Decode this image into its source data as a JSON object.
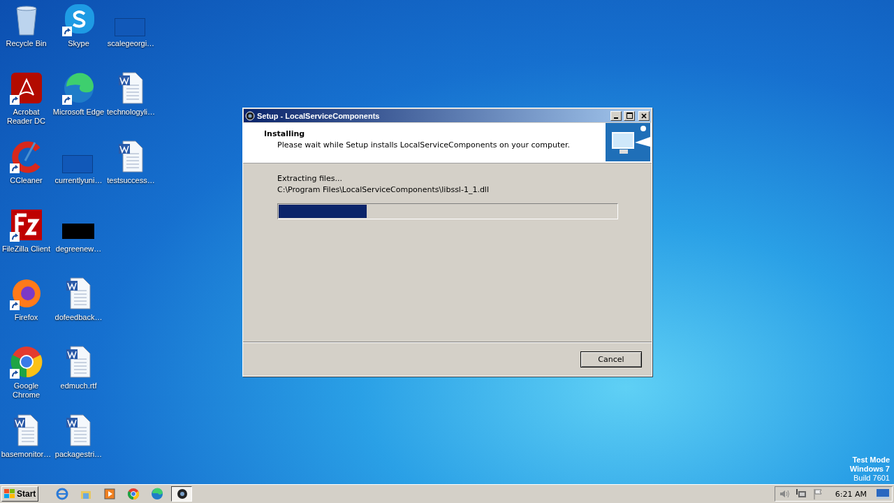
{
  "desktop_icons": [
    {
      "label": "Recycle Bin",
      "kind": "recycle",
      "shortcut": false
    },
    {
      "label": "Acrobat Reader DC",
      "kind": "acrobat",
      "shortcut": true
    },
    {
      "label": "CCleaner",
      "kind": "ccleaner",
      "shortcut": true
    },
    {
      "label": "FileZilla Client",
      "kind": "filezilla",
      "shortcut": true
    },
    {
      "label": "Firefox",
      "kind": "firefox",
      "shortcut": true
    },
    {
      "label": "Google Chrome",
      "kind": "chrome",
      "shortcut": true
    },
    {
      "label": "basemonitor…",
      "kind": "word",
      "shortcut": false
    },
    {
      "label": "Skype",
      "kind": "skype",
      "shortcut": true
    },
    {
      "label": "Microsoft Edge",
      "kind": "edge",
      "shortcut": true
    },
    {
      "label": "currentlyuni…",
      "kind": "blank",
      "shortcut": false
    },
    {
      "label": "degreenew…",
      "kind": "dark",
      "shortcut": false
    },
    {
      "label": "dofeedback…",
      "kind": "word",
      "shortcut": false
    },
    {
      "label": "edmuch.rtf",
      "kind": "word",
      "shortcut": false
    },
    {
      "label": "packagestri…",
      "kind": "word",
      "shortcut": false
    },
    {
      "label": "scalegeorgi…",
      "kind": "blank",
      "shortcut": false
    },
    {
      "label": "technologyli…",
      "kind": "word",
      "shortcut": false
    },
    {
      "label": "testsuccess…",
      "kind": "word",
      "shortcut": false
    }
  ],
  "window": {
    "title": "Setup - LocalServiceComponents",
    "heading": "Installing",
    "subheading": "Please wait while Setup installs LocalServiceComponents on your computer.",
    "status": "Extracting files...",
    "file": "C:\\Program Files\\LocalServiceComponents\\libssl-1_1.dll",
    "progress": {
      "level": 0.26
    },
    "buttons": [
      "Cancel"
    ]
  },
  "watermark_text": [
    "Test Mode",
    "Windows 7",
    "Build 7601"
  ],
  "taskbar": {
    "start": "Start",
    "quick_launch": [
      {
        "kind": "ie"
      },
      {
        "kind": "explorer"
      },
      {
        "kind": "media"
      },
      {
        "kind": "chrome"
      },
      {
        "kind": "edge"
      }
    ],
    "tasks": [
      {
        "kind": "setup",
        "selected": true
      }
    ],
    "tray_icons": [
      {
        "kind": "volume"
      },
      {
        "kind": "network"
      },
      {
        "kind": "flag"
      }
    ],
    "clock": "6:21 AM"
  }
}
